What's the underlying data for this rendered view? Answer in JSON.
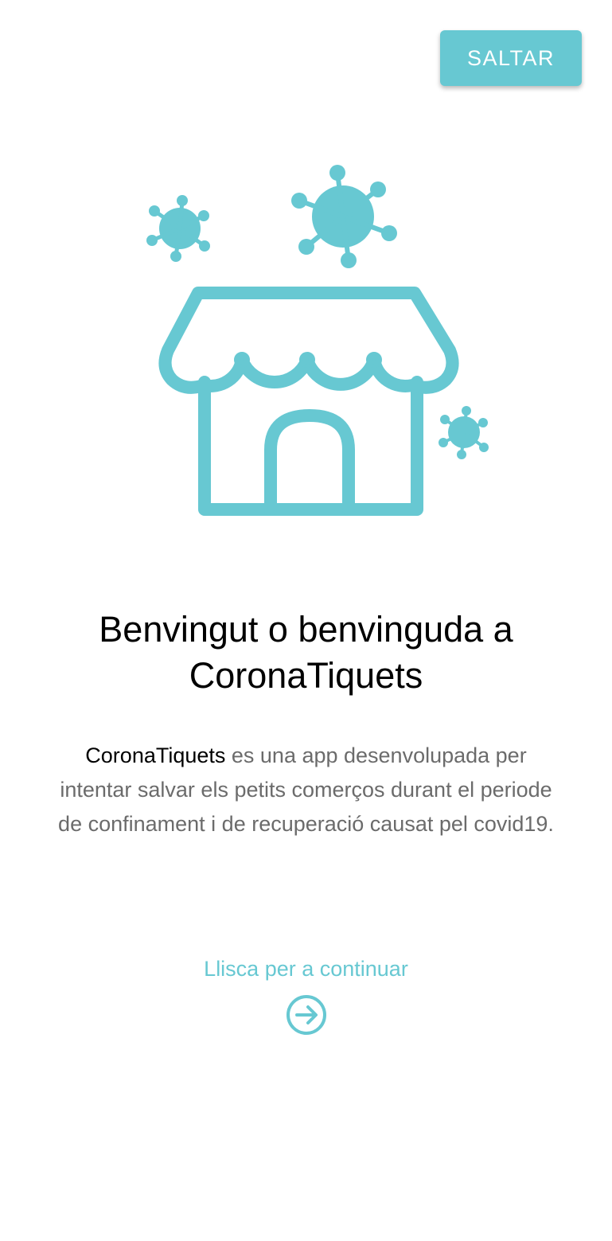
{
  "header": {
    "skip_label": "SALTAR"
  },
  "hero": {
    "icon": "shop-with-virus-icon"
  },
  "welcome": {
    "title": "Benvingut o benvinguda a CoronaTiquets",
    "description_brand": "CoronaTiquets",
    "description_text": " es una app desenvolupada per intentar salvar els petits comerços durant el periode de confinament i de recuperació causat pel covid19."
  },
  "footer": {
    "swipe_hint": "Llisca per a continuar",
    "next_icon": "arrow-right-circle-icon"
  },
  "colors": {
    "accent": "#67c8d2",
    "title": "#000000",
    "body_text": "#6b6b6b",
    "background": "#ffffff"
  }
}
